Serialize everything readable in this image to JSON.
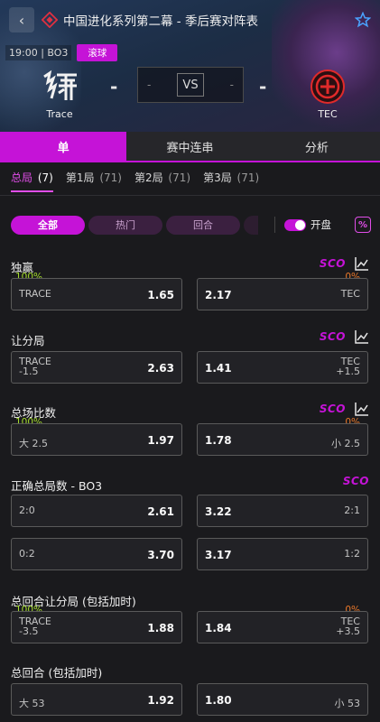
{
  "header": {
    "back_icon": "chevron-left-icon",
    "league_title": "中国进化系列第二幕 - 季后赛对阵表",
    "time": "19:00 | BO3",
    "live_label": "滚球",
    "team_left": "Trace",
    "team_right": "TEC",
    "score_left": "-",
    "score_right": "-",
    "vs": "VS",
    "vs_left_dash": "-",
    "vs_right_dash": "-"
  },
  "main_tabs": [
    {
      "label": "单"
    },
    {
      "label": "赛中连串"
    },
    {
      "label": "分析"
    }
  ],
  "round_tabs": [
    {
      "label": "总局",
      "count": "(7)"
    },
    {
      "label": "第1局",
      "count": "(71)"
    },
    {
      "label": "第2局",
      "count": "(71)"
    },
    {
      "label": "第3局",
      "count": "(71)"
    }
  ],
  "filters": {
    "all": "全部",
    "hot": "热门",
    "round": "回合",
    "open_label": "开盘",
    "pct_icon": "%"
  },
  "brand": "SCO",
  "colors": {
    "accent": "#c513d7",
    "green": "#a4dc2c",
    "orange": "#e8772a"
  },
  "markets": [
    {
      "title": "独赢",
      "pct_left": "100%",
      "pct_right": "0%",
      "rows": [
        {
          "left_label": "TRACE",
          "left_label2": "",
          "left_value": "1.65",
          "right_value": "2.17",
          "right_label": "TEC",
          "right_label2": ""
        }
      ]
    },
    {
      "title": "让分局",
      "rows": [
        {
          "left_label": "TRACE",
          "left_label2": "-1.5",
          "left_value": "2.63",
          "right_value": "1.41",
          "right_label": "TEC",
          "right_label2": "+1.5"
        }
      ]
    },
    {
      "title": "总场比数",
      "pct_left": "100%",
      "pct_right": "0%",
      "rows": [
        {
          "left_label": "大 2.5",
          "left_label2": "",
          "left_value": "1.97",
          "right_value": "1.78",
          "right_label": "小 2.5",
          "right_label2": ""
        }
      ]
    },
    {
      "title": "正确总局数 - BO3",
      "rows": [
        {
          "left_label": "2:0",
          "left_label2": "",
          "left_value": "2.61",
          "right_value": "3.22",
          "right_label": "2:1",
          "right_label2": ""
        },
        {
          "left_label": "0:2",
          "left_label2": "",
          "left_value": "3.70",
          "right_value": "3.17",
          "right_label": "1:2",
          "right_label2": ""
        }
      ]
    },
    {
      "title": "总回合让分局 (包括加时)",
      "pct_left": "100%",
      "pct_right": "0%",
      "rows": [
        {
          "left_label": "TRACE",
          "left_label2": "-3.5",
          "left_value": "1.88",
          "right_value": "1.84",
          "right_label": "TEC",
          "right_label2": "+3.5"
        }
      ]
    },
    {
      "title": "总回合 (包括加时)",
      "rows": [
        {
          "left_label": "大 53",
          "left_label2": "",
          "left_value": "1.92",
          "right_value": "1.80",
          "right_label": "小 53",
          "right_label2": ""
        }
      ]
    }
  ]
}
